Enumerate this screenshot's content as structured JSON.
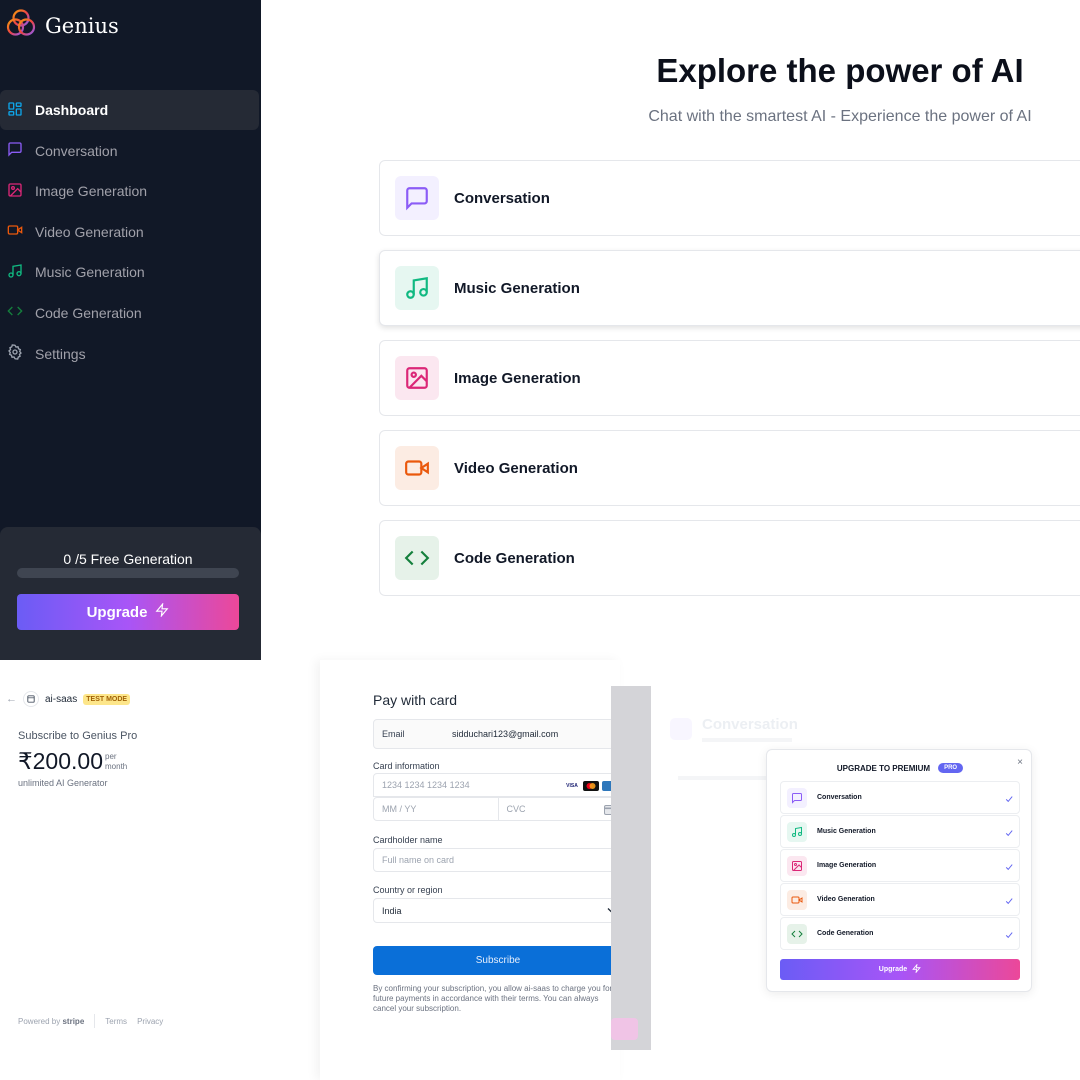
{
  "app": {
    "name": "Genius"
  },
  "sidebar": {
    "items": [
      {
        "label": "Dashboard",
        "icon": "dashboard-icon",
        "color": "#0ea5e9"
      },
      {
        "label": "Conversation",
        "icon": "message-square-icon",
        "color": "#8b5cf6"
      },
      {
        "label": "Image Generation",
        "icon": "image-icon",
        "color": "#db2777"
      },
      {
        "label": "Video Generation",
        "icon": "video-icon",
        "color": "#ea580c"
      },
      {
        "label": "Music Generation",
        "icon": "music-icon",
        "color": "#10b981"
      },
      {
        "label": "Code Generation",
        "icon": "code-icon",
        "color": "#15803d"
      },
      {
        "label": "Settings",
        "icon": "settings-icon",
        "color": "#9ca3af"
      }
    ],
    "free_counter": "0 /5 Free Generation",
    "free_progress": 0,
    "upgrade_label": "Upgrade"
  },
  "main": {
    "title": "Explore the power of AI",
    "subtitle": "Chat with the smartest AI - Experience the power of AI",
    "tools": [
      {
        "label": "Conversation",
        "icon": "message-square-icon",
        "color": "#8b5cf6",
        "bg": "#f3f0ff"
      },
      {
        "label": "Music Generation",
        "icon": "music-icon",
        "color": "#10b981",
        "bg": "#e6f7f1"
      },
      {
        "label": "Image Generation",
        "icon": "image-icon",
        "color": "#db2777",
        "bg": "#fbe7f0"
      },
      {
        "label": "Video Generation",
        "icon": "video-icon",
        "color": "#ea580c",
        "bg": "#fcece3"
      },
      {
        "label": "Code Generation",
        "icon": "code-icon",
        "color": "#15803d",
        "bg": "#e6f2e9"
      }
    ]
  },
  "checkout": {
    "merchant": "ai-saas",
    "test_mode": "TEST MODE",
    "subscribe_title": "Subscribe to Genius Pro",
    "price": "₹200.00",
    "per": "per",
    "period": "month",
    "description": "unlimited AI Generator",
    "powered_by": "Powered by",
    "stripe": "stripe",
    "terms": "Terms",
    "privacy": "Privacy",
    "pay_title": "Pay with card",
    "email_label": "Email",
    "email_value": "sidduchari123@gmail.com",
    "card_info_label": "Card information",
    "card_placeholder": "1234 1234 1234 1234",
    "expiry_placeholder": "MM / YY",
    "cvc_placeholder": "CVC",
    "cardholder_label": "Cardholder name",
    "cardholder_placeholder": "Full name on card",
    "country_label": "Country or region",
    "country_value": "India",
    "subscribe_button": "Subscribe",
    "legal_text": "By confirming your subscription, you allow ai-saas to charge you for future payments in accordance with their terms. You can always cancel your subscription.",
    "card_brands": [
      "VISA",
      "mastercard",
      "amex"
    ]
  },
  "pro_modal": {
    "background_title": "Conversation",
    "title": "UPGRADE TO PREMIUM",
    "badge": "PRO",
    "close": "×",
    "items": [
      {
        "label": "Conversation",
        "icon": "message-square-icon",
        "color": "#8b5cf6",
        "bg": "#f3f0ff"
      },
      {
        "label": "Music Generation",
        "icon": "music-icon",
        "color": "#10b981",
        "bg": "#e6f7f1"
      },
      {
        "label": "Image Generation",
        "icon": "image-icon",
        "color": "#db2777",
        "bg": "#fbe7f0"
      },
      {
        "label": "Video Generation",
        "icon": "video-icon",
        "color": "#ea580c",
        "bg": "#fcece3"
      },
      {
        "label": "Code Generation",
        "icon": "code-icon",
        "color": "#15803d",
        "bg": "#e6f2e9"
      }
    ],
    "upgrade_label": "Upgrade"
  }
}
